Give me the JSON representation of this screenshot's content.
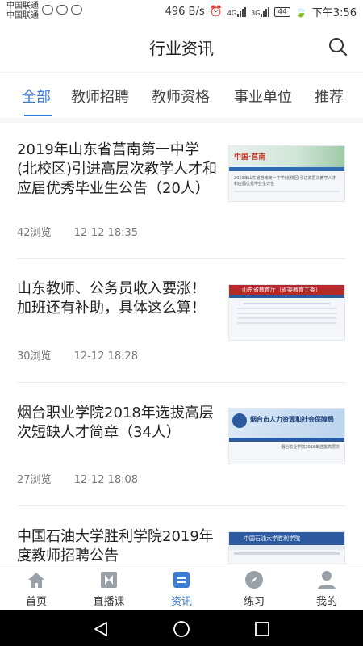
{
  "status_bar": {
    "carrier_1": "中国联通",
    "carrier_2": "中国联通",
    "speed": "496 B/s",
    "network_1": "4G",
    "network_2": "3G",
    "battery": "44",
    "time": "下午3:56"
  },
  "header": {
    "title": "行业资讯"
  },
  "tabs": [
    {
      "label": "全部",
      "active": true
    },
    {
      "label": "教师招聘",
      "active": false
    },
    {
      "label": "教师资格",
      "active": false
    },
    {
      "label": "事业单位",
      "active": false
    },
    {
      "label": "推荐",
      "active": false
    }
  ],
  "articles": [
    {
      "title": "2019年山东省莒南第一中学(北校区)引进高层次教学人才和应届优秀毕业生公告（20人）",
      "views": "42浏览",
      "date": "12-12 18:35",
      "thumb_header": "中国·莒南",
      "thumb_caption": "2019年山东省莒南第一中学(北校区)引进高层次教学人才和应届优秀毕业生公告"
    },
    {
      "title": "山东教师、公务员收入要涨！加班还有补助，具体这么算！",
      "views": "30浏览",
      "date": "12-12 18:28",
      "thumb_header": "山东省教育厅（省委教育工委）",
      "thumb_caption": ""
    },
    {
      "title": "烟台职业学院2018年选拔高层次短缺人才简章（34人）",
      "views": "27浏览",
      "date": "12-12 18:08",
      "thumb_header": "烟台市人力资源和社会保障局",
      "thumb_caption": "烟台职业学院2018年选拔高层次"
    },
    {
      "title": "中国石油大学胜利学院2019年度教师招聘公告",
      "views": "",
      "date": "",
      "thumb_header": "中国石油大学胜利学院",
      "thumb_caption": ""
    }
  ],
  "bottom_nav": [
    {
      "label": "首页",
      "icon": "home-icon",
      "active": false
    },
    {
      "label": "直播课",
      "icon": "live-icon",
      "active": false
    },
    {
      "label": "资讯",
      "icon": "news-icon",
      "active": true
    },
    {
      "label": "练习",
      "icon": "compass-icon",
      "active": false
    },
    {
      "label": "我的",
      "icon": "user-icon",
      "active": false
    }
  ],
  "colors": {
    "accent": "#3a7bd5",
    "text": "#222222",
    "meta": "#777777",
    "nav_inactive": "#9aa0a8"
  }
}
